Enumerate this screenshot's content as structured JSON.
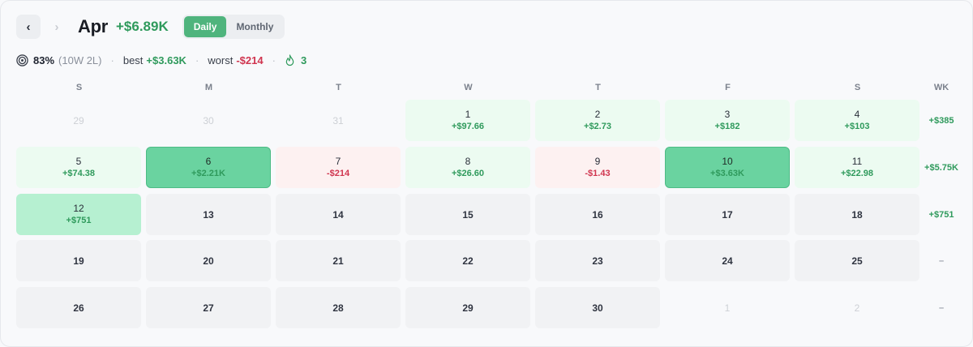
{
  "header": {
    "prev_icon": "chevron-left-icon",
    "next_icon": "chevron-right-icon",
    "month": "Apr",
    "total": "+$6.89K",
    "view_options": [
      "Daily",
      "Monthly"
    ],
    "active_view": "Daily"
  },
  "stats": {
    "win_rate": "83%",
    "record": "(10W 2L)",
    "best_label": "best",
    "best_value": "+$3.63K",
    "worst_label": "worst",
    "worst_value": "-$214",
    "streak": "3"
  },
  "calendar": {
    "weekday_headers": [
      "S",
      "M",
      "T",
      "W",
      "T",
      "F",
      "S"
    ],
    "week_header": "WK",
    "weeks": [
      {
        "days": [
          {
            "day": "29",
            "pnl": "",
            "state": "out"
          },
          {
            "day": "30",
            "pnl": "",
            "state": "out"
          },
          {
            "day": "31",
            "pnl": "",
            "state": "out"
          },
          {
            "day": "1",
            "pnl": "+$97.66",
            "state": "pos-light"
          },
          {
            "day": "2",
            "pnl": "+$2.73",
            "state": "pos-light"
          },
          {
            "day": "3",
            "pnl": "+$182",
            "state": "pos-light"
          },
          {
            "day": "4",
            "pnl": "+$103",
            "state": "pos-light"
          }
        ],
        "total": "+$385"
      },
      {
        "days": [
          {
            "day": "5",
            "pnl": "+$74.38",
            "state": "pos-light"
          },
          {
            "day": "6",
            "pnl": "+$2.21K",
            "state": "pos-strong"
          },
          {
            "day": "7",
            "pnl": "-$214",
            "state": "neg-light"
          },
          {
            "day": "8",
            "pnl": "+$26.60",
            "state": "pos-light"
          },
          {
            "day": "9",
            "pnl": "-$1.43",
            "state": "neg-light"
          },
          {
            "day": "10",
            "pnl": "+$3.63K",
            "state": "pos-strong"
          },
          {
            "day": "11",
            "pnl": "+$22.98",
            "state": "pos-light"
          }
        ],
        "total": "+$5.75K"
      },
      {
        "days": [
          {
            "day": "12",
            "pnl": "+$751",
            "state": "pos-med"
          },
          {
            "day": "13",
            "pnl": "",
            "state": "empty"
          },
          {
            "day": "14",
            "pnl": "",
            "state": "empty"
          },
          {
            "day": "15",
            "pnl": "",
            "state": "empty"
          },
          {
            "day": "16",
            "pnl": "",
            "state": "empty"
          },
          {
            "day": "17",
            "pnl": "",
            "state": "empty"
          },
          {
            "day": "18",
            "pnl": "",
            "state": "empty"
          }
        ],
        "total": "+$751"
      },
      {
        "days": [
          {
            "day": "19",
            "pnl": "",
            "state": "empty"
          },
          {
            "day": "20",
            "pnl": "",
            "state": "empty"
          },
          {
            "day": "21",
            "pnl": "",
            "state": "empty"
          },
          {
            "day": "22",
            "pnl": "",
            "state": "empty"
          },
          {
            "day": "23",
            "pnl": "",
            "state": "empty"
          },
          {
            "day": "24",
            "pnl": "",
            "state": "empty"
          },
          {
            "day": "25",
            "pnl": "",
            "state": "empty"
          }
        ],
        "total": "–"
      },
      {
        "days": [
          {
            "day": "26",
            "pnl": "",
            "state": "empty"
          },
          {
            "day": "27",
            "pnl": "",
            "state": "empty"
          },
          {
            "day": "28",
            "pnl": "",
            "state": "empty"
          },
          {
            "day": "29",
            "pnl": "",
            "state": "empty"
          },
          {
            "day": "30",
            "pnl": "",
            "state": "empty"
          },
          {
            "day": "1",
            "pnl": "",
            "state": "out"
          },
          {
            "day": "2",
            "pnl": "",
            "state": "out"
          }
        ],
        "total": "–"
      }
    ]
  },
  "colors": {
    "positive": "#2f9a5c",
    "negative": "#d0354f",
    "accent": "#4fb47d"
  }
}
